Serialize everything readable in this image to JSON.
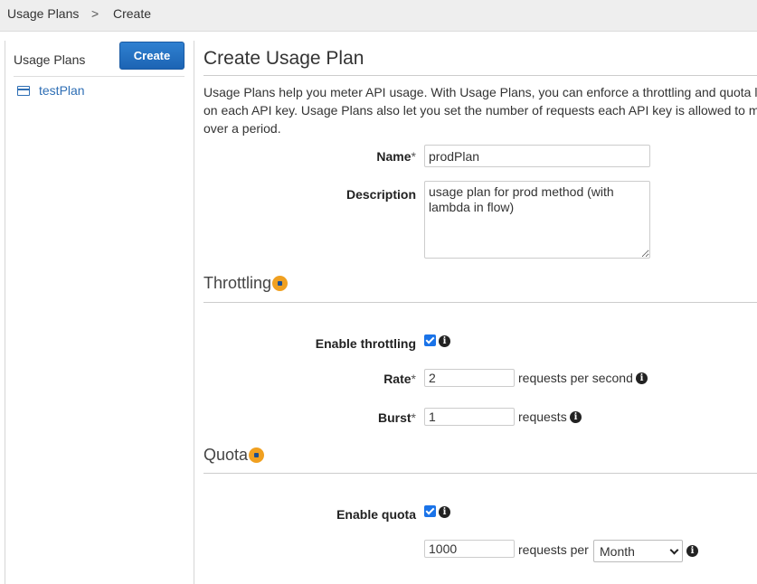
{
  "breadcrumb": {
    "root": "Usage Plans",
    "separator": ">",
    "current": "Create"
  },
  "sidebar": {
    "title": "Usage Plans",
    "create_label": "Create",
    "items": [
      {
        "label": "testPlan",
        "icon": "card-icon"
      }
    ]
  },
  "main": {
    "title": "Create Usage Plan",
    "intro": "Usage Plans help you meter API usage. With Usage Plans, you can enforce a throttling and quota limit on each API key. Usage Plans also let you set the number of requests each API key is allowed to make over a period.",
    "name": {
      "label": "Name",
      "required": "*",
      "value": "prodPlan"
    },
    "description": {
      "label": "Description",
      "value": "usage plan for prod method (with lambda in flow)"
    },
    "throttling": {
      "title": "Throttling",
      "enable_label": "Enable throttling",
      "enabled": true,
      "rate": {
        "label": "Rate",
        "required": "*",
        "value": "2",
        "unit": "requests per second"
      },
      "burst": {
        "label": "Burst",
        "required": "*",
        "value": "1",
        "unit": "requests"
      }
    },
    "quota": {
      "title": "Quota",
      "enable_label": "Enable quota",
      "enabled": true,
      "value": "1000",
      "unit": "requests per",
      "period": "Month"
    }
  },
  "colors": {
    "primary_button": "#1c64b4",
    "link": "#2f6fb5",
    "checkbox": "#1a73e8",
    "help_dot": "#f0a020"
  }
}
